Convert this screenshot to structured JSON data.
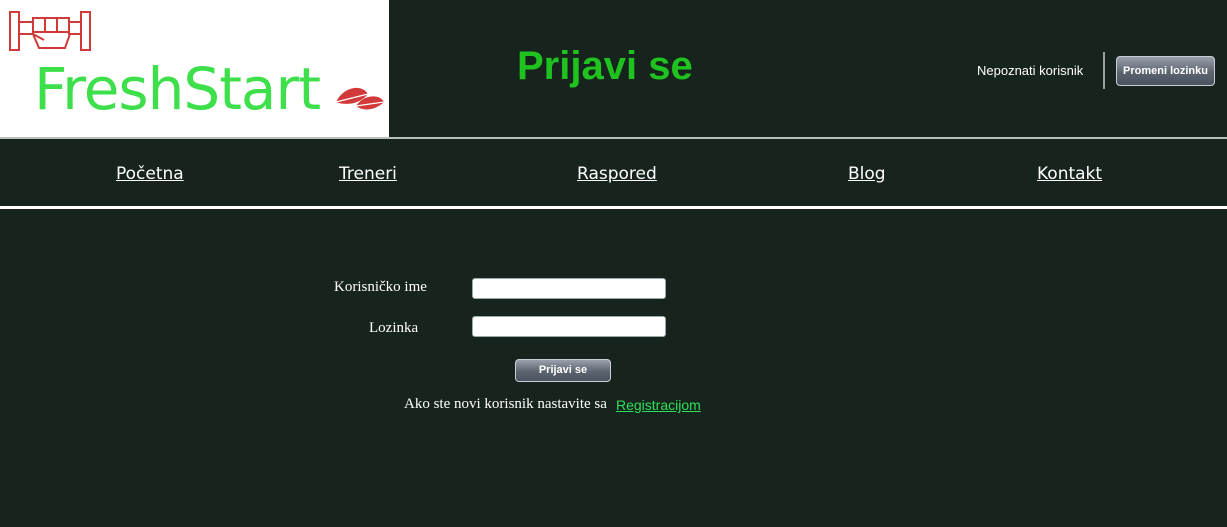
{
  "header": {
    "logo_text": "FreshStart",
    "title": "Prijavi se",
    "user_label": "Nepoznati korisnik",
    "change_password_label": "Promeni lozinku"
  },
  "nav": {
    "items": [
      {
        "label": "Početna"
      },
      {
        "label": "Treneri"
      },
      {
        "label": "Raspored"
      },
      {
        "label": "Blog"
      },
      {
        "label": "Kontakt"
      }
    ]
  },
  "login_form": {
    "username_label": "Korisničko ime",
    "username_value": "",
    "password_label": "Lozinka",
    "password_value": "",
    "submit_label": "Prijavi se",
    "register_prompt": "Ako ste novi korisnik nastavite sa",
    "register_link": "Registracijom"
  },
  "colors": {
    "background": "#16241d",
    "title_green": "#1fc21f",
    "logo_green": "#3de04a",
    "logo_red": "#d23a3a",
    "link_green": "#2ee05a"
  },
  "icons": {
    "logo_mark": "raised-fist-icon",
    "logo_leaf": "leaf-icon"
  }
}
